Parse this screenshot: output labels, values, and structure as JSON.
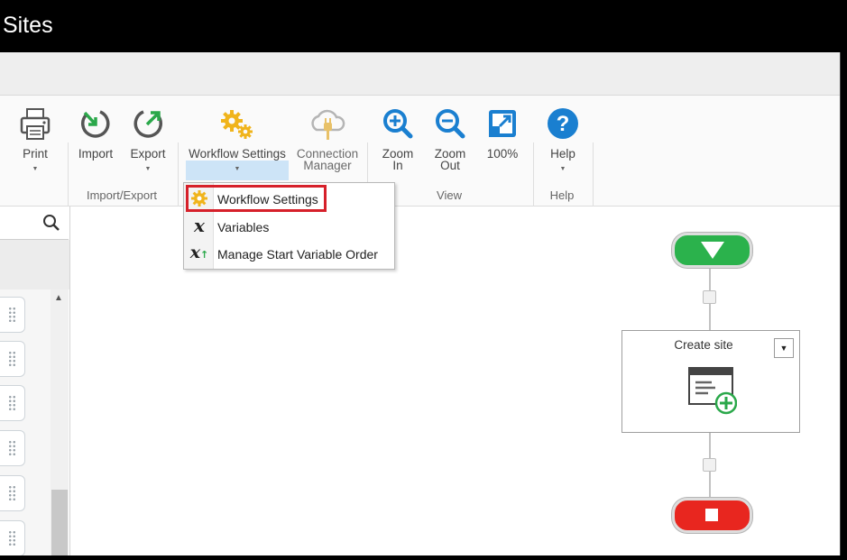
{
  "window": {
    "title": "Sites"
  },
  "ribbon": {
    "print": {
      "label": "Print",
      "icon": "printer-icon"
    },
    "import": {
      "label": "Import",
      "icon": "import-icon"
    },
    "export": {
      "label": "Export",
      "icon": "export-icon"
    },
    "import_export_group": "Import/Export",
    "workflow_settings": {
      "label": "Workflow Settings",
      "icon": "gears-icon"
    },
    "connection_manager": {
      "label_line1": "Connection",
      "label_line2": "Manager",
      "icon": "cloud-plug-icon"
    },
    "zoom_in": {
      "label_line1": "Zoom",
      "label_line2": "In",
      "icon": "zoom-in-icon"
    },
    "zoom_out": {
      "label_line1": "Zoom",
      "label_line2": "Out",
      "icon": "zoom-out-icon"
    },
    "zoom_100": {
      "label": "100%",
      "icon": "fit-icon"
    },
    "view_group": "View",
    "help": {
      "label": "Help",
      "icon": "help-icon"
    },
    "help_group": "Help"
  },
  "dropdown": {
    "items": [
      {
        "label": "Workflow Settings",
        "icon": "gear-icon"
      },
      {
        "label": "Variables",
        "icon": "variable-icon"
      },
      {
        "label": "Manage Start Variable Order",
        "icon": "variable-order-icon"
      }
    ]
  },
  "workflow": {
    "action_title": "Create site",
    "action_icon": "create-site-icon"
  },
  "colors": {
    "accent_blue": "#1a7fd0",
    "start_green": "#2bb24c",
    "end_red": "#e8261f",
    "highlight_red": "#d6202a",
    "gear_yellow": "#f0b41c"
  }
}
